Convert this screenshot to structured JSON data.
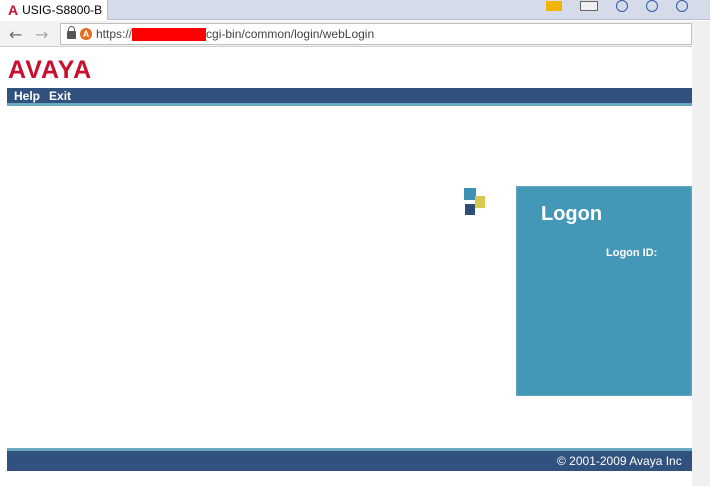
{
  "browser": {
    "tab_title": "USIG-S8800-B",
    "tab_icon_glyph": "A",
    "address": {
      "scheme": "https://",
      "url_tail": "cgi-bin/common/login/webLogin",
      "warn_glyph": "A"
    },
    "nav": {
      "back": "←",
      "forward": "→"
    }
  },
  "page": {
    "logo": "AVAYA",
    "nav_items": [
      "Help",
      "Exit"
    ],
    "logon": {
      "title": "Logon",
      "id_label": "Logon ID:"
    },
    "footer": "© 2001-2009 Avaya Inc"
  },
  "colors": {
    "brand_red": "#c8102e",
    "nav_blue": "#31517f",
    "accent_teal": "#6ba9c0",
    "panel_blue": "#4398b7"
  }
}
